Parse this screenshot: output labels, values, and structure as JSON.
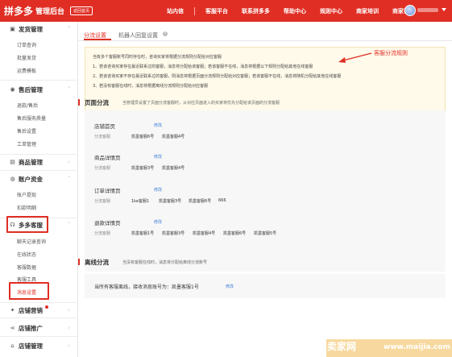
{
  "header": {
    "logo": "拼多多",
    "admin_label": "管理后台",
    "back_home": "返回首页",
    "nav": [
      "站内信",
      "客服平台",
      "联系拼多多",
      "帮助中心",
      "规则中心",
      "商家培训",
      "商家社区"
    ]
  },
  "sidebar": {
    "groups": [
      {
        "label": "发货管理",
        "icon": "truck-icon",
        "items": [
          "订单查询",
          "批量发货",
          "运费模板"
        ]
      },
      {
        "label": "售后管理",
        "icon": "refund-icon",
        "items": [
          "退款/售后",
          "售后服务质量",
          "售后设置",
          "工单管理"
        ]
      },
      {
        "label": "商品管理",
        "icon": "box-icon",
        "items": []
      },
      {
        "label": "账户资金",
        "icon": "wallet-icon",
        "items": [
          "账户提现",
          "扣款明细"
        ]
      },
      {
        "label": "多多客服",
        "icon": "headset-icon",
        "items": [
          "聊天记录查询",
          "在线状态",
          "客服数据",
          "客服工具",
          "消息设置"
        ]
      },
      {
        "label": "店铺营销",
        "icon": "gift-icon",
        "items": []
      },
      {
        "label": "店铺推广",
        "icon": "share-icon",
        "items": []
      },
      {
        "label": "店铺管理",
        "icon": "shop-icon",
        "items": []
      }
    ]
  },
  "tabs": [
    "分流设置",
    "机器人回复设置"
  ],
  "notice": {
    "lines": [
      "当有多个客服账号同时存在时，咨询买家将根据分流规则分配给对应客服",
      "1、若该咨询买家存在最近联系过的客服，消息将分配给该客服；若该客服不在线，消息将根据以下规则分配给其他在线客服",
      "2、若该咨询买家不存在最近联系过的客服，则消息将根据页面分流规则分配给对应客服；若该客服不在线，消息将随机分配给其他在线客服",
      "3、若没有客服在线时，消息将根据离线分流规则分配给对应客服"
    ],
    "annotation": "客服分流规则"
  },
  "page_section": {
    "title": "页面分流",
    "desc": "当管理员设置了页面分流客服时，从对应页面进入的买家将优先分配给该页面的分流客服"
  },
  "pages": [
    {
      "title": "店铺首页",
      "link": "修改",
      "label": "分流客服",
      "values": [
        "凯墨客服6号",
        "凯墨客服4号"
      ]
    },
    {
      "title": "商品详情页",
      "link": "修改",
      "label": "分流客服",
      "values": [
        "凯墨客服3号",
        "凯墨客服4号"
      ]
    },
    {
      "title": "订单详情页",
      "link": "修改",
      "label": "分流客服",
      "values": [
        "1ke客服1",
        "凯墨客服3号",
        "凯墨客服6号",
        "666"
      ]
    },
    {
      "title": "退款详情页",
      "link": "修改",
      "label": "分流客服",
      "values": [
        "凯墨客服1号",
        "凯墨客服3号",
        "凯墨客服4号",
        "凯墨客服6号",
        "凯墨客服5号"
      ]
    }
  ],
  "offline_section": {
    "title": "离线分流",
    "desc": "当没有客服在线时，消息将分配给离线分流账号",
    "text": "当所有客服离线，接收消息账号为：凯墨客服1号",
    "link": "修改"
  },
  "watermark": {
    "brand": "卖家网",
    "url": "www.maijia.com"
  },
  "colors": {
    "brand": "#e02e24",
    "link": "#3c7fd9",
    "notice_bg": "#fffaea"
  }
}
